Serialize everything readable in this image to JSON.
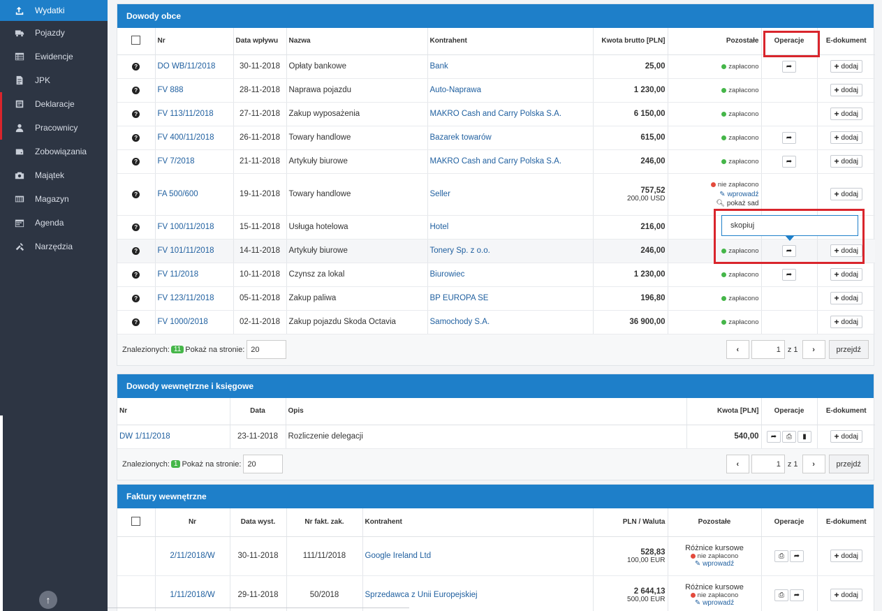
{
  "sidebar": {
    "items": [
      {
        "label": "Wydatki",
        "icon": "upload-icon",
        "active": true
      },
      {
        "label": "Pojazdy",
        "icon": "truck-icon"
      },
      {
        "label": "Ewidencje",
        "icon": "table-icon"
      },
      {
        "label": "JPK",
        "icon": "document-icon"
      },
      {
        "label": "Deklaracje",
        "icon": "declaration-icon"
      },
      {
        "label": "Pracownicy",
        "icon": "user-icon"
      },
      {
        "label": "Zobowiązania",
        "icon": "wallet-icon"
      },
      {
        "label": "Majątek",
        "icon": "camera-icon"
      },
      {
        "label": "Magazyn",
        "icon": "warehouse-icon"
      },
      {
        "label": "Agenda",
        "icon": "calendar-icon"
      },
      {
        "label": "Narzędzia",
        "icon": "tools-icon"
      }
    ]
  },
  "colors": {
    "accent": "#1e7fc9",
    "sidebar": "#2d3543",
    "paid": "#45b649",
    "unpaid": "#e34a3c",
    "highlight_box": "#d9252c"
  },
  "external": {
    "title": "Dowody obce",
    "headers": [
      "Nr",
      "Data wpływu",
      "Nazwa",
      "Kontrahent",
      "Kwota brutto [PLN]",
      "Pozostałe",
      "Operacje",
      "E-dokument"
    ],
    "rows": [
      {
        "nr": "DO WB/11/2018",
        "date": "30-11-2018",
        "name": "Opłaty bankowe",
        "contractor": "Bank",
        "amount": "25,00",
        "status": "zapłacono",
        "op": true
      },
      {
        "nr": "FV 888",
        "date": "28-11-2018",
        "name": "Naprawa pojazdu",
        "contractor": "Auto-Naprawa",
        "amount": "1 230,00",
        "status": "zapłacono",
        "op": false
      },
      {
        "nr": "FV 113/11/2018",
        "date": "27-11-2018",
        "name": "Zakup wyposażenia",
        "contractor": "MAKRO Cash and Carry Polska S.A.",
        "amount": "6 150,00",
        "status": "zapłacono",
        "op": false
      },
      {
        "nr": "FV 400/11/2018",
        "date": "26-11-2018",
        "name": "Towary handlowe",
        "contractor": "Bazarek towarów",
        "amount": "615,00",
        "status": "zapłacono",
        "op": true
      },
      {
        "nr": "FV 7/2018",
        "date": "21-11-2018",
        "name": "Artykuły biurowe",
        "contractor": "MAKRO Cash and Carry Polska S.A.",
        "amount": "246,00",
        "status": "zapłacono",
        "op": true
      },
      {
        "nr": "FA 500/600",
        "date": "19-11-2018",
        "name": "Towary handlowe",
        "contractor": "Seller",
        "amount": "757,52",
        "amount_sub": "200,00 USD",
        "status": "nie zapłacono",
        "unpaid": true,
        "action1": "wprowadź",
        "action2": "pokaż sad",
        "op": false
      },
      {
        "nr": "FV 100/11/2018",
        "date": "15-11-2018",
        "name": "Usługa hotelowa",
        "contractor": "Hotel",
        "amount": "216,00",
        "status": "",
        "op": false,
        "noadd": true
      },
      {
        "nr": "FV 101/11/2018",
        "date": "14-11-2018",
        "name": "Artykuły biurowe",
        "contractor": "Tonery Sp. z o.o.",
        "amount": "246,00",
        "status": "zapłacono",
        "op": true,
        "hl": true
      },
      {
        "nr": "FV 11/2018",
        "date": "10-11-2018",
        "name": "Czynsz za lokal",
        "contractor": "Biurowiec",
        "amount": "1 230,00",
        "status": "zapłacono",
        "op": true
      },
      {
        "nr": "FV 123/11/2018",
        "date": "05-11-2018",
        "name": "Zakup paliwa",
        "contractor": "BP EUROPA SE",
        "amount": "196,80",
        "status": "zapłacono",
        "op": false
      },
      {
        "nr": "FV 1000/2018",
        "date": "02-11-2018",
        "name": "Zakup pojazdu Skoda Octavia",
        "contractor": "Samochody S.A.",
        "amount": "36 900,00",
        "status": "zapłacono",
        "op": false
      }
    ],
    "found_label": "Znalezionych:",
    "found_count": "11",
    "per_page_label": "Pokaż na stronie:",
    "per_page": "20",
    "page": "1",
    "page_of": "z 1",
    "go_label": "przejdź"
  },
  "tooltip": "skopiuj",
  "add_label": "dodaj",
  "internal": {
    "title": "Dowody wewnętrzne i księgowe",
    "headers": [
      "Nr",
      "Data",
      "Opis",
      "Kwota [PLN]",
      "Operacje",
      "E-dokument"
    ],
    "rows": [
      {
        "nr": "DW 1/11/2018",
        "date": "23-11-2018",
        "desc": "Rozliczenie delegacji",
        "amount": "540,00"
      }
    ],
    "found_label": "Znalezionych:",
    "found_count": "1",
    "per_page_label": "Pokaż na stronie:",
    "per_page": "20",
    "page": "1",
    "page_of": "z 1",
    "go_label": "przejdź"
  },
  "invoices": {
    "title": "Faktury wewnętrzne",
    "headers": [
      "Nr",
      "Data wyst.",
      "Nr fakt. zak.",
      "Kontrahent",
      "PLN / Waluta",
      "Pozostałe",
      "Operacje",
      "E-dokument"
    ],
    "rows": [
      {
        "nr": "2/11/2018/W",
        "date": "30-11-2018",
        "inv": "111/11/2018",
        "contractor": "Google Ireland Ltd",
        "amount": "528,83",
        "amount_sub": "100,00 EUR",
        "rem": "Różnice kursowe",
        "status": "nie zapłacono",
        "action": "wprowadź"
      },
      {
        "nr": "1/11/2018/W",
        "date": "29-11-2018",
        "inv": "50/2018",
        "contractor": "Sprzedawca z Unii Europejskiej",
        "amount": "2 644,13",
        "amount_sub": "500,00 EUR",
        "rem": "Różnice kursowe",
        "status": "nie zapłacono",
        "action": "wprowadź"
      }
    ]
  }
}
